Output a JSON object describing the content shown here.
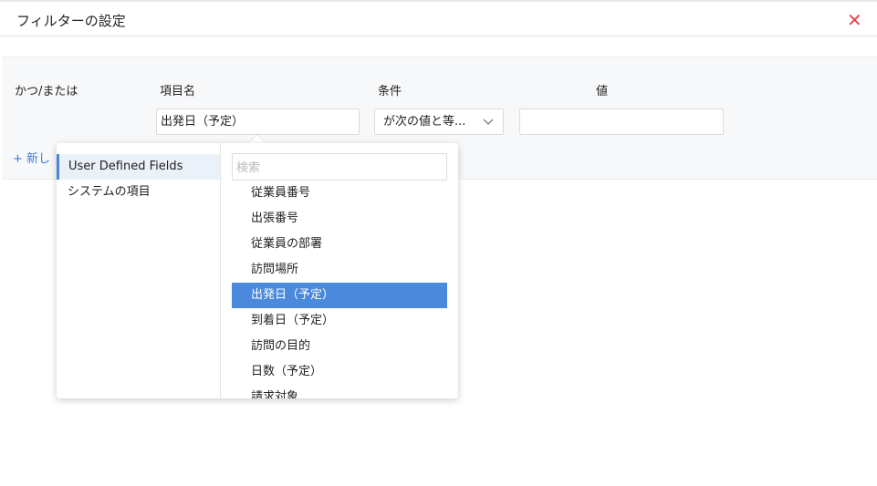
{
  "dialog": {
    "title": "フィルターの設定",
    "close_icon": "close-icon"
  },
  "columns": {
    "andor": "かつ/または",
    "field": "項目名",
    "condition": "条件",
    "value": "値"
  },
  "row": {
    "field_value": "出発日（予定）",
    "condition_value": "が次の値と等...",
    "value_value": ""
  },
  "add_label": "+ 新し",
  "dropdown": {
    "categories": [
      {
        "label": "User Defined Fields",
        "active": true
      },
      {
        "label": "システムの項目",
        "active": false
      }
    ],
    "search_placeholder": "検索",
    "items": [
      "従業員番号",
      "出張番号",
      "従業員の部署",
      "訪問場所",
      "出発日（予定）",
      "到着日（予定）",
      "訪問の目的",
      "日数（予定）",
      "請求対象"
    ],
    "selected_index": 4
  },
  "colors": {
    "accent": "#4a89dc",
    "close": "#e5484d"
  }
}
